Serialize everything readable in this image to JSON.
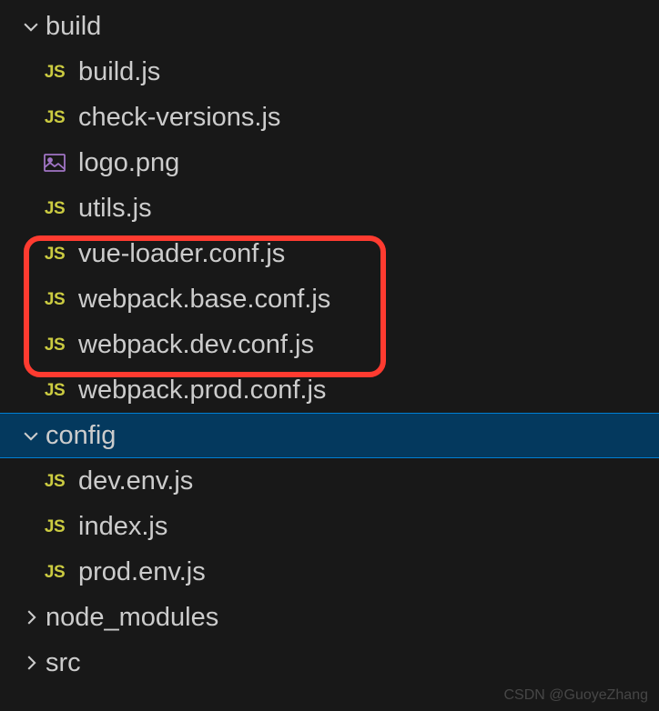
{
  "tree": {
    "folders": [
      {
        "name": "build",
        "expanded": true,
        "selected": false,
        "children": [
          {
            "name": "build.js",
            "type": "js"
          },
          {
            "name": "check-versions.js",
            "type": "js"
          },
          {
            "name": "logo.png",
            "type": "image"
          },
          {
            "name": "utils.js",
            "type": "js"
          },
          {
            "name": "vue-loader.conf.js",
            "type": "js"
          },
          {
            "name": "webpack.base.conf.js",
            "type": "js"
          },
          {
            "name": "webpack.dev.conf.js",
            "type": "js"
          },
          {
            "name": "webpack.prod.conf.js",
            "type": "js"
          }
        ]
      },
      {
        "name": "config",
        "expanded": true,
        "selected": true,
        "children": [
          {
            "name": "dev.env.js",
            "type": "js"
          },
          {
            "name": "index.js",
            "type": "js"
          },
          {
            "name": "prod.env.js",
            "type": "js"
          }
        ]
      },
      {
        "name": "node_modules",
        "expanded": false,
        "selected": false
      },
      {
        "name": "src",
        "expanded": false,
        "selected": false
      }
    ]
  },
  "icons": {
    "js_label": "JS"
  },
  "watermark": "CSDN @GuoyeZhang"
}
